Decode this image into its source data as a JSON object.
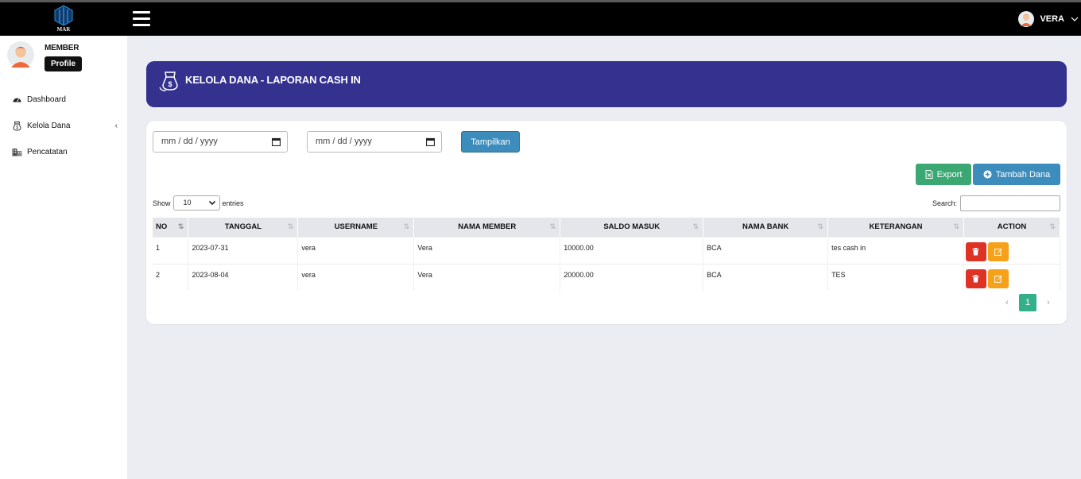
{
  "header": {
    "logo_text": "MAR",
    "user_name": "VERA"
  },
  "sidebar": {
    "role": "MEMBER",
    "profile_button": "Profile",
    "items": [
      {
        "label": "Dashboard",
        "icon": "dashboard-icon"
      },
      {
        "label": "Kelola Dana",
        "icon": "money-bag-icon"
      },
      {
        "label": "Pencatatan",
        "icon": "building-icon"
      }
    ]
  },
  "banner": {
    "title": "KELOLA DANA - LAPORAN CASH IN",
    "icon": "money-bag-icon"
  },
  "filters": {
    "date_from_placeholder": "mm / dd / yyyy",
    "date_to_placeholder": "mm / dd / yyyy",
    "show_button": "Tampilkan"
  },
  "actions": {
    "export_label": "Export",
    "add_label": "Tambah Dana"
  },
  "table_controls": {
    "show_label": "Show",
    "entries_value": "10",
    "entries_label": "entries",
    "search_label": "Search:"
  },
  "table": {
    "columns": [
      "NO",
      "TANGGAL",
      "USERNAME",
      "NAMA MEMBER",
      "SALDO MASUK",
      "NAMA BANK",
      "KETERANGAN",
      "ACTION"
    ],
    "rows": [
      {
        "no": "1",
        "tanggal": "2023-07-31",
        "username": "vera",
        "nama_member": "Vera",
        "saldo_masuk": "10000.00",
        "nama_bank": "BCA",
        "keterangan": "tes cash in"
      },
      {
        "no": "2",
        "tanggal": "2023-08-04",
        "username": "vera",
        "nama_member": "Vera",
        "saldo_masuk": "20000.00",
        "nama_bank": "BCA",
        "keterangan": "TES"
      }
    ]
  },
  "pagination": {
    "prev": "‹",
    "current": "1",
    "next": "›"
  },
  "colors": {
    "banner": "#34318f",
    "topbar": "#000000",
    "export": "#3ba873",
    "primary": "#3c8dbc",
    "delete": "#dd3224",
    "edit": "#f5a21a",
    "page_active": "#33b08a"
  }
}
